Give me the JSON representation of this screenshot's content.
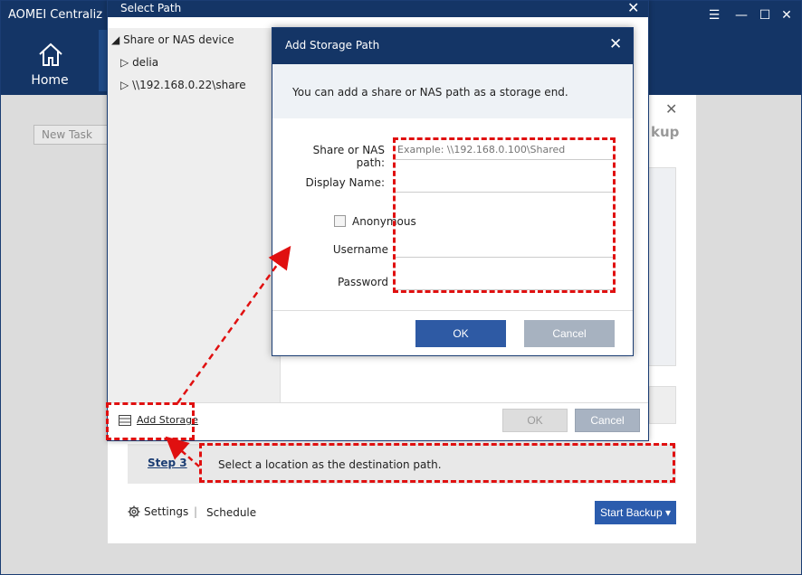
{
  "app": {
    "title": "AOMEI Centraliz",
    "nav_home_label": "Home",
    "new_task_label": "New Task"
  },
  "backup_panel": {
    "title_fragment": "kup",
    "step3_label": "Step 3",
    "step3_text": "Select a location as the destination path.",
    "settings_label": "Settings",
    "separator": "|",
    "schedule_label": "Schedule",
    "start_backup_label": "Start Backup"
  },
  "select_path": {
    "title": "Select Path",
    "tree_root": "Share or NAS device",
    "tree_items": [
      "delia",
      "\\\\192.168.0.22\\share"
    ],
    "add_storage_label": "Add Storage",
    "ok_label": "OK",
    "cancel_label": "Cancel"
  },
  "add_storage_dialog": {
    "title": "Add Storage Path",
    "info_text": "You can add a share or NAS path as a storage end.",
    "share_path_label": "Share or NAS path:",
    "share_path_placeholder": "Example: \\\\192.168.0.100\\Shared",
    "display_name_label": "Display Name:",
    "anonymous_label": "Anonymous",
    "username_label": "Username",
    "password_label": "Password",
    "ok_label": "OK",
    "cancel_label": "Cancel"
  },
  "colors": {
    "titlebar": "#143566",
    "primary_button": "#2e5aa4",
    "annotation": "#e01010"
  }
}
